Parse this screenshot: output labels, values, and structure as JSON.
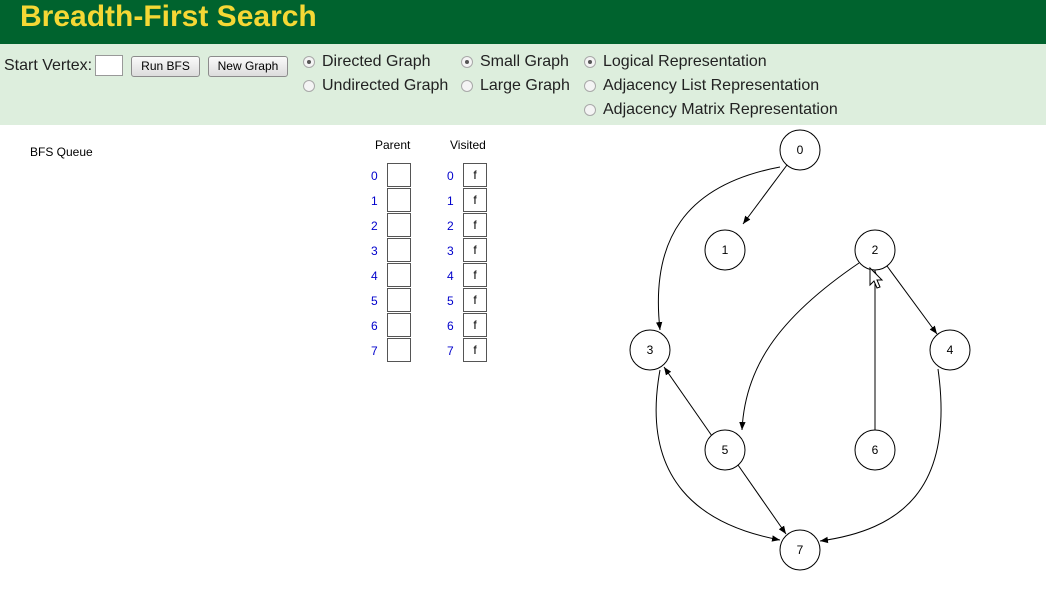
{
  "header": {
    "title": "Breadth-First Search"
  },
  "controls": {
    "start_vertex_label": "Start Vertex:",
    "start_vertex_value": "",
    "run_button": "Run BFS",
    "new_graph_button": "New Graph",
    "graph_direction": [
      {
        "label": "Directed Graph",
        "checked": true
      },
      {
        "label": "Undirected Graph",
        "checked": false
      }
    ],
    "graph_size": [
      {
        "label": "Small Graph",
        "checked": true
      },
      {
        "label": "Large Graph",
        "checked": false
      }
    ],
    "representation": [
      {
        "label": "Logical Representation",
        "checked": true
      },
      {
        "label": "Adjacency List Representation",
        "checked": false
      },
      {
        "label": "Adjacency Matrix Representation",
        "checked": false
      }
    ]
  },
  "queue": {
    "label": "BFS Queue"
  },
  "parent_table": {
    "header": "Parent",
    "indices": [
      "0",
      "1",
      "2",
      "3",
      "4",
      "5",
      "6",
      "7"
    ],
    "values": [
      "",
      "",
      "",
      "",
      "",
      "",
      "",
      ""
    ]
  },
  "visited_table": {
    "header": "Visited",
    "indices": [
      "0",
      "1",
      "2",
      "3",
      "4",
      "5",
      "6",
      "7"
    ],
    "values": [
      "f",
      "f",
      "f",
      "f",
      "f",
      "f",
      "f",
      "f"
    ]
  },
  "graph": {
    "vertices": [
      "0",
      "1",
      "2",
      "3",
      "4",
      "5",
      "6",
      "7"
    ],
    "edges": [
      [
        0,
        1
      ],
      [
        0,
        3
      ],
      [
        2,
        4
      ],
      [
        2,
        5
      ],
      [
        4,
        7
      ],
      [
        5,
        3
      ],
      [
        5,
        7
      ],
      [
        3,
        7
      ],
      [
        6,
        2
      ]
    ]
  },
  "colors": {
    "header_bg": "#00632e",
    "title_text": "#f5d835",
    "controls_bg": "#ddeedd",
    "index_text": "#0000cc"
  }
}
